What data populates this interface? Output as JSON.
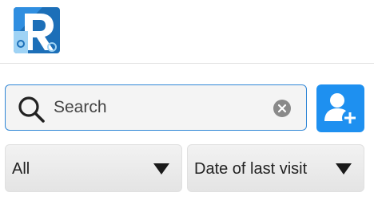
{
  "header": {
    "logo_icon": "app-logo-r-icon"
  },
  "search": {
    "value": "",
    "placeholder": "Search",
    "icon": "search-icon",
    "clear_icon": "clear-icon",
    "border_color": "#2f86d6"
  },
  "toolbar": {
    "add_user_icon": "add-user-icon",
    "accent_color": "#1e90f0"
  },
  "filters": {
    "filter_value": "All",
    "sort_value": "Date of last visit"
  }
}
